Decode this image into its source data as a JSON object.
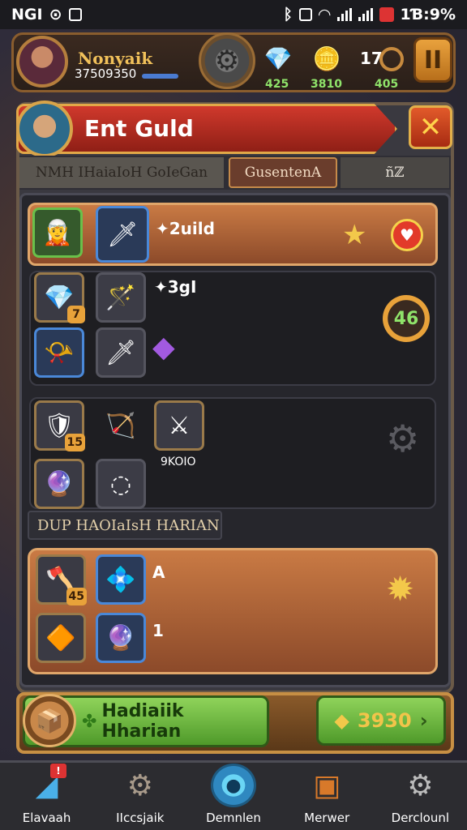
{
  "status_bar": {
    "left_text": "NGI",
    "right_text": "1Ɓ:9%"
  },
  "hud": {
    "player_name": "Nonyaik",
    "player_xp": "37509350",
    "resources": [
      {
        "icon": "💎",
        "value": "425"
      },
      {
        "icon": "🪙",
        "value": "3810"
      },
      {
        "icon": "",
        "value": "405"
      }
    ],
    "counter": "17"
  },
  "dialog": {
    "title": "Ent Guld",
    "close_label": "✕",
    "tabs": [
      "NMH IHaiaIoH GoIeGan",
      "GusentenA",
      "ñℤ"
    ]
  },
  "items": {
    "featured_label": "✦2uild",
    "group1_label": "✦3gI",
    "group1_level": "46",
    "group2_label": "9KOIO",
    "section_title": "DUP HAOIaIsH HARIAN",
    "group3_label_a": "A",
    "group3_label_b": "1",
    "badges": {
      "b1": "7",
      "b2": "15",
      "b3": "45"
    }
  },
  "cta": {
    "left_label": "Hadiaiik Hharian",
    "right_value": "3930"
  },
  "nav": [
    {
      "label": "Elavaah",
      "icon": "crystal-icon"
    },
    {
      "label": "IIccsjaik",
      "icon": "gear-icon"
    },
    {
      "label": "Demnlen",
      "icon": "orb-icon"
    },
    {
      "label": "Merwer",
      "icon": "chest-icon"
    },
    {
      "label": "Derclounl",
      "icon": "settings-icon"
    }
  ]
}
